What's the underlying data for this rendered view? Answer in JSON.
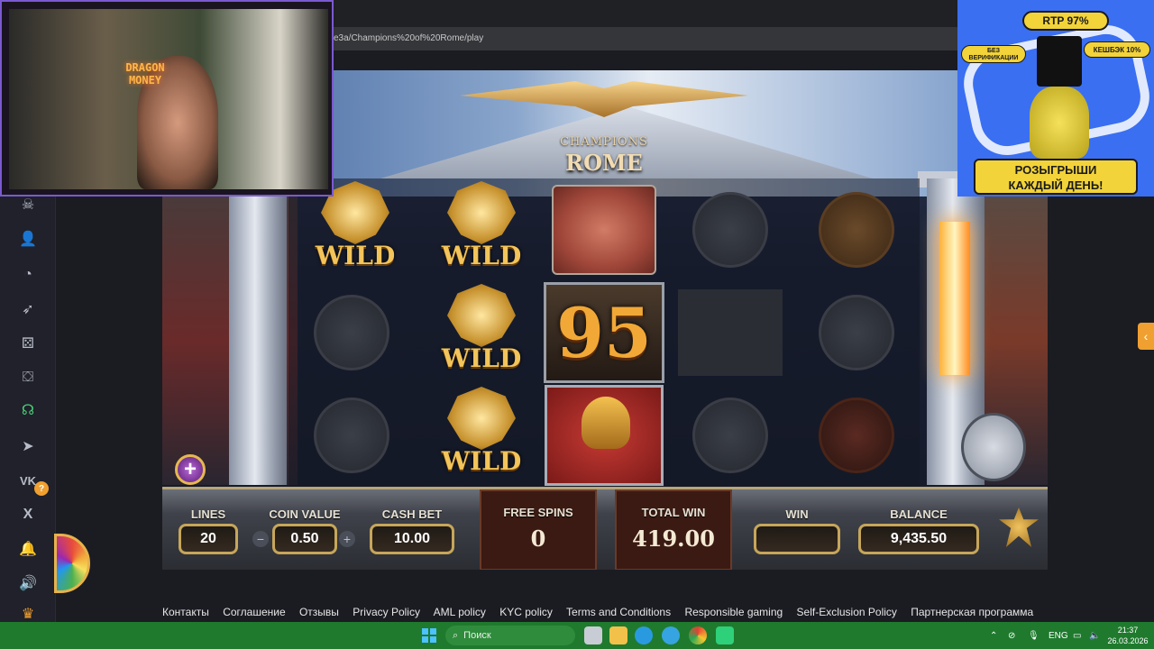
{
  "browser": {
    "url_fragment": "e3a/Champions%20of%20Rome/play"
  },
  "game": {
    "logo_line1": "CHAMPIONS",
    "logo_line2": "ROME",
    "wild_label": "WILD",
    "big_number": "95",
    "panel": {
      "lines_label": "LINES",
      "lines_value": "20",
      "coin_value_label": "COIN VALUE",
      "coin_value": "0.50",
      "cash_bet_label": "CASH BET",
      "cash_bet_value": "10.00",
      "free_spins_label": "FREE SPINS",
      "free_spins_value": "0",
      "total_win_label": "TOTAL WIN",
      "total_win_value": "419.00",
      "win_label": "WIN",
      "win_value": "",
      "balance_label": "BALANCE",
      "balance_value": "9,435.50",
      "minus_symbol": "−",
      "plus_symbol": "+"
    },
    "plus_symbol": "+"
  },
  "sidebar": {
    "badge": "?"
  },
  "footer": {
    "links": [
      "Контакты",
      "Соглашение",
      "Отзывы",
      "Privacy Policy",
      "AML policy",
      "KYC policy",
      "Terms and Conditions",
      "Responsible gaming",
      "Self-Exclusion Policy",
      "Партнерская программа"
    ]
  },
  "webcam": {
    "sign": "DRAGON MONEY"
  },
  "ad": {
    "rtp": "RTP 97%",
    "no_verification": "БЕЗ ВЕРИФИКАЦИИ",
    "cashback": "КЕШБЭК 10%",
    "banner_line1": "РОЗЫГРЫШИ",
    "banner_line2": "КАЖДЫЙ ДЕНЬ!"
  },
  "taskbar": {
    "search_placeholder": "Поиск",
    "lang": "ENG",
    "time": "21:37",
    "date": "26.03.2026"
  },
  "colors": {
    "taskbar": "#1f7a2e",
    "accent_orange": "#f0a030",
    "ad_blue": "#3a6ff2",
    "gold": "#c6a65a"
  }
}
